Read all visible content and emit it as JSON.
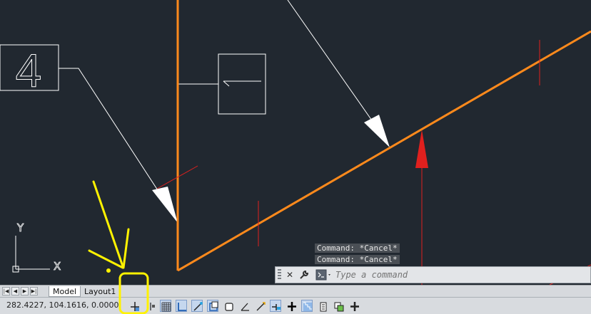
{
  "command_history": [
    "Command: *Cancel*",
    "Command: *Cancel*"
  ],
  "command_line": {
    "placeholder": "Type a command",
    "close_icon": "close-icon",
    "customize_icon": "wrench-icon",
    "prompt_icon": "command-prompt-icon"
  },
  "layout_tabs": [
    {
      "label": "Model",
      "active": true
    },
    {
      "label": "Layout1",
      "active": false
    }
  ],
  "tab_nav_icons": [
    "first-tab-icon",
    "previous-tab-icon",
    "next-tab-icon",
    "last-tab-icon"
  ],
  "status": {
    "coordinates": "282.4227, 104.1616, 0.0000"
  },
  "status_buttons": [
    {
      "name": "infer-constraints-button",
      "icon": "infer-constraints-icon",
      "on": false
    },
    {
      "name": "snap-mode-button",
      "icon": "snap-icon",
      "on": false
    },
    {
      "name": "grid-display-button",
      "icon": "grid-icon",
      "on": true
    },
    {
      "name": "ortho-mode-button",
      "icon": "ortho-icon",
      "on": true
    },
    {
      "name": "polar-tracking-button",
      "icon": "polar-icon",
      "on": true
    },
    {
      "name": "object-snap-button",
      "icon": "osnap-icon",
      "on": true
    },
    {
      "name": "3d-object-snap-button",
      "icon": "3d-osnap-icon",
      "on": false
    },
    {
      "name": "object-snap-tracking-button",
      "icon": "otrack-icon",
      "on": false
    },
    {
      "name": "dynamic-ucs-button",
      "icon": "ducs-icon",
      "on": false
    },
    {
      "name": "dynamic-input-button",
      "icon": "dyn-icon",
      "on": true
    },
    {
      "name": "lineweight-button",
      "icon": "lineweight-icon",
      "on": false
    },
    {
      "name": "transparency-button",
      "icon": "transparency-icon",
      "on": true
    },
    {
      "name": "quick-properties-button",
      "icon": "quick-properties-icon",
      "on": false
    },
    {
      "name": "selection-cycling-button",
      "icon": "selection-cycling-icon",
      "on": false
    },
    {
      "name": "annotation-monitor-button",
      "icon": "annotation-monitor-icon",
      "on": false
    }
  ],
  "drawing": {
    "tag_label": "4",
    "ucs_y": "Y",
    "ucs_x": "X"
  },
  "colors": {
    "background": "#212830",
    "orange_lines": "#ff8a1c",
    "red_marks": "#e0201e",
    "white_lines": "#ffffff",
    "highlight_annotation": "#fff200"
  }
}
